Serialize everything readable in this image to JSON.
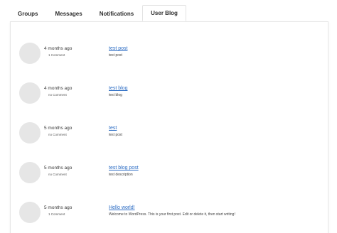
{
  "tabs": [
    {
      "label": "Groups",
      "active": false
    },
    {
      "label": "Messages",
      "active": false
    },
    {
      "label": "Notifications",
      "active": false
    },
    {
      "label": "User Blog",
      "active": true
    }
  ],
  "entries": [
    {
      "time": "4 months ago",
      "comments": "1 Comment",
      "title": "test post",
      "description": "test post"
    },
    {
      "time": "4 months ago",
      "comments": "no Comment",
      "title": "test blog",
      "description": "test blog"
    },
    {
      "time": "5 months ago",
      "comments": "no Comment",
      "title": "test",
      "description": "test post"
    },
    {
      "time": "5 months ago",
      "comments": "no Comment",
      "title": "test blog post",
      "description": "test description"
    },
    {
      "time": "5 months ago",
      "comments": "1 Comment",
      "title": "Hello world!",
      "description": "Welcome to WordPress. This is your first post. Edit or delete it, then start writing!"
    }
  ],
  "colors": {
    "link": "#2b6cc4",
    "avatar": "#e6e6e6",
    "border": "#e2e2e2"
  }
}
